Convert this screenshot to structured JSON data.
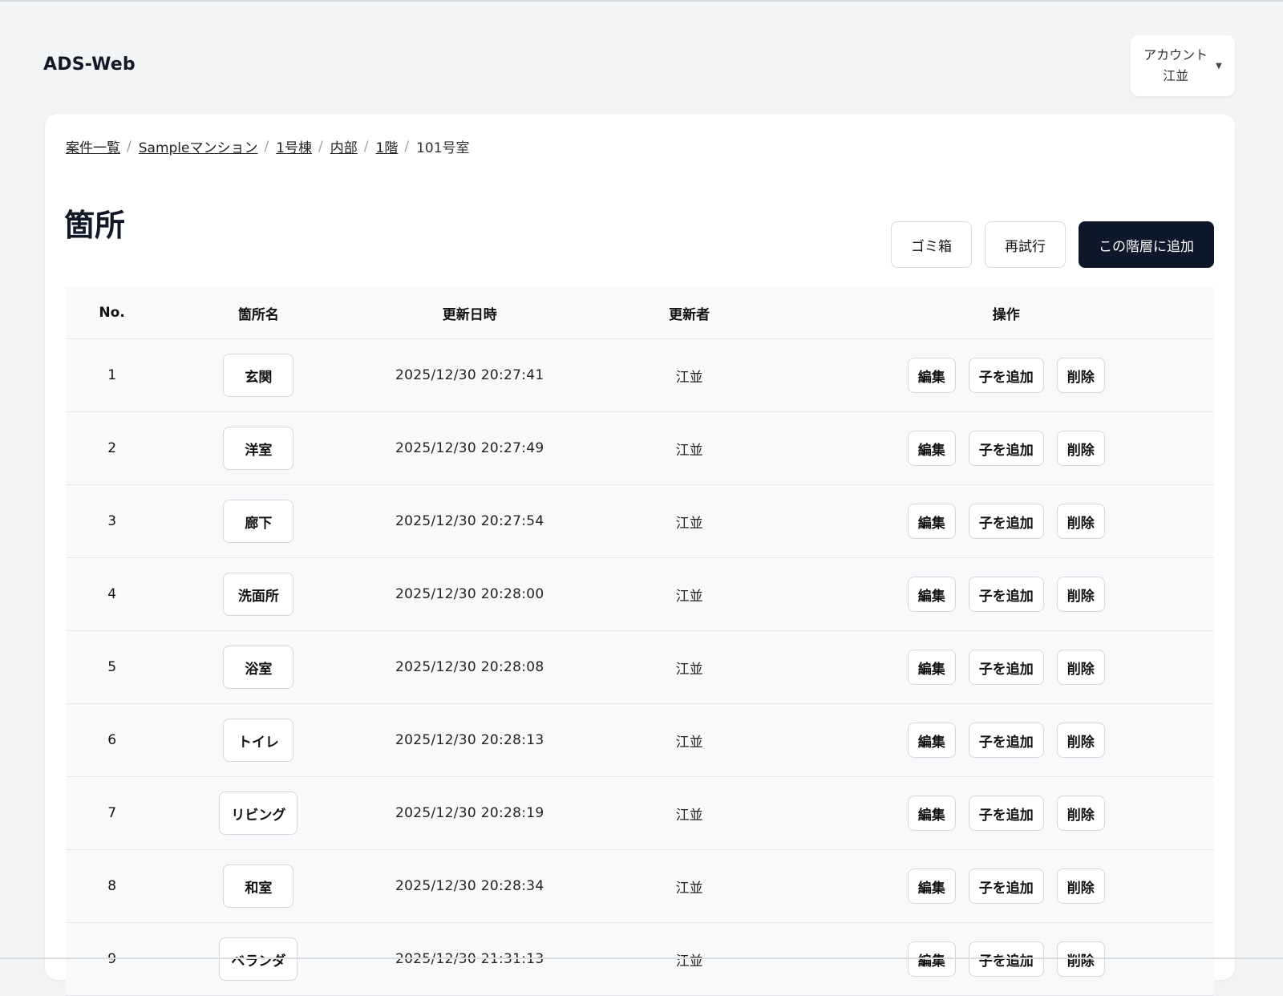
{
  "app": {
    "brand": "ADS-Web"
  },
  "account": {
    "label": "アカウント",
    "user": "江並"
  },
  "breadcrumb": [
    {
      "label": "案件一覧"
    },
    {
      "label": "Sampleマンション"
    },
    {
      "label": "1号棟"
    },
    {
      "label": "内部"
    },
    {
      "label": "1階"
    }
  ],
  "breadcrumb_current": "101号室",
  "page": {
    "title": "箇所"
  },
  "actions": {
    "trash": "ゴミ箱",
    "retry": "再試行",
    "add": "この階層に追加"
  },
  "table": {
    "headers": {
      "no": "No.",
      "name": "箇所名",
      "updated_at": "更新日時",
      "updated_by": "更新者",
      "ops": "操作"
    },
    "op_labels": {
      "edit": "編集",
      "add_child": "子を追加",
      "delete": "削除"
    },
    "rows": [
      {
        "no": "1",
        "name": "玄関",
        "updated_at": "2025/12/30 20:27:41",
        "updated_by": "江並"
      },
      {
        "no": "2",
        "name": "洋室",
        "updated_at": "2025/12/30 20:27:49",
        "updated_by": "江並"
      },
      {
        "no": "3",
        "name": "廊下",
        "updated_at": "2025/12/30 20:27:54",
        "updated_by": "江並"
      },
      {
        "no": "4",
        "name": "洗面所",
        "updated_at": "2025/12/30 20:28:00",
        "updated_by": "江並"
      },
      {
        "no": "5",
        "name": "浴室",
        "updated_at": "2025/12/30 20:28:08",
        "updated_by": "江並"
      },
      {
        "no": "6",
        "name": "トイレ",
        "updated_at": "2025/12/30 20:28:13",
        "updated_by": "江並"
      },
      {
        "no": "7",
        "name": "リビング",
        "updated_at": "2025/12/30 20:28:19",
        "updated_by": "江並"
      },
      {
        "no": "8",
        "name": "和室",
        "updated_at": "2025/12/30 20:28:34",
        "updated_by": "江並"
      },
      {
        "no": "9",
        "name": "ベランダ",
        "updated_at": "2025/12/30 21:31:13",
        "updated_by": "江並"
      }
    ]
  },
  "colors": {
    "primary": "#0f172a",
    "background": "#f3f4f5",
    "row_bg": "#f8f9fa",
    "border": "#e5e7eb"
  }
}
